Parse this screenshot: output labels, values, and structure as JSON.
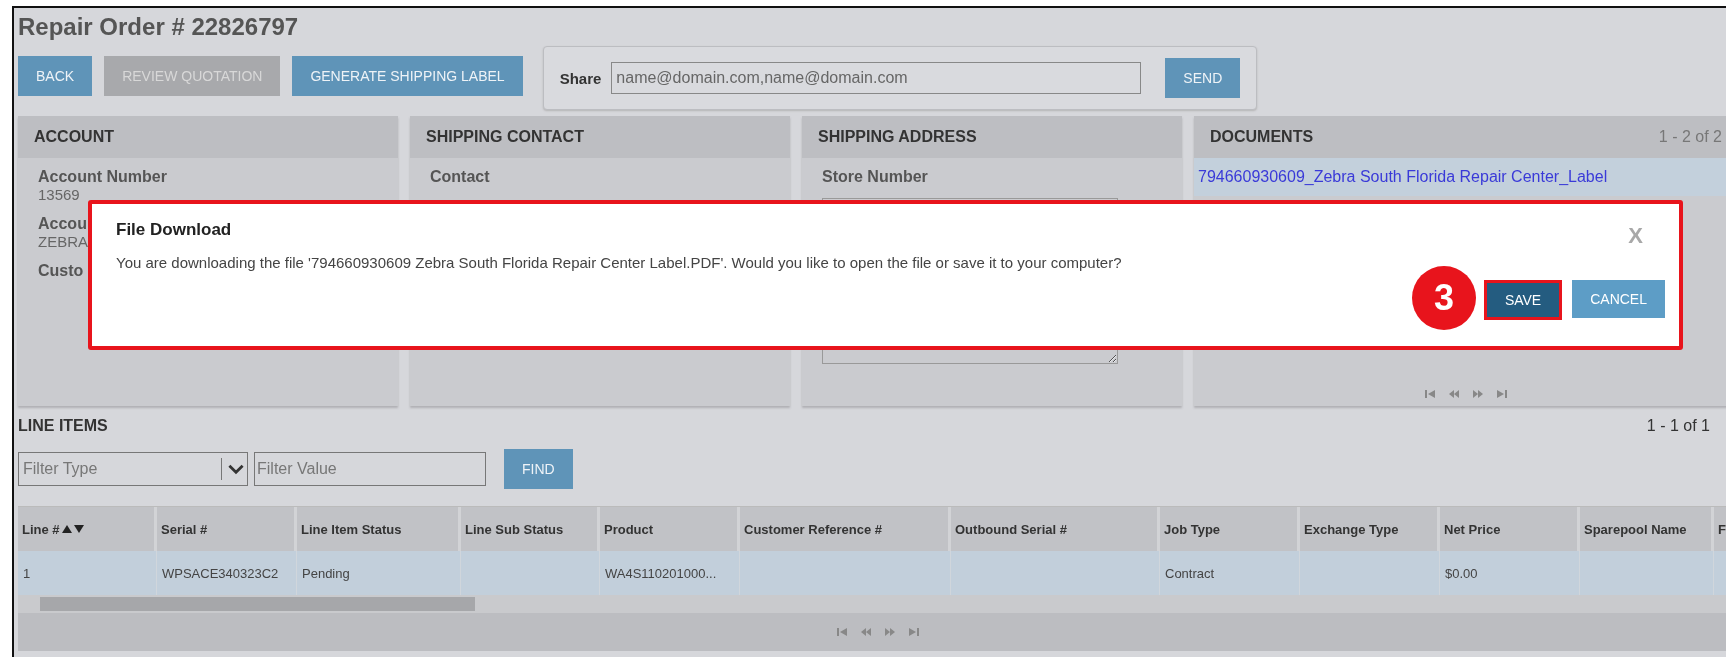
{
  "title": "Repair Order # 22826797",
  "toolbar": [
    {
      "label": "BACK",
      "disabled": false
    },
    {
      "label": "REVIEW QUOTATION",
      "disabled": true
    },
    {
      "label": "GENERATE SHIPPING LABEL",
      "disabled": false
    }
  ],
  "share": {
    "label": "Share",
    "placeholder": "name@domain.com,name@domain.com",
    "button": "SEND"
  },
  "panels": [
    {
      "kind": "fields",
      "title": "ACCOUNT",
      "fields": [
        {
          "kind": "text",
          "label": "Account Number",
          "value": "13569"
        },
        {
          "kind": "text",
          "label": "Accou",
          "value": "ZEBRA"
        },
        {
          "kind": "text",
          "label": "Custo"
        }
      ]
    },
    {
      "kind": "fields",
      "title": "SHIPPING CONTACT",
      "fields": [
        {
          "kind": "text",
          "label": "Contact"
        }
      ]
    },
    {
      "kind": "fields",
      "title": "SHIPPING ADDRESS",
      "fields": [
        {
          "kind": "text",
          "label": "Store Number"
        },
        {
          "kind": "textarea"
        }
      ]
    },
    {
      "kind": "documents",
      "title": "DOCUMENTS",
      "count": "1 - 2 of 2",
      "documents": [
        {
          "name": "794660930609_Zebra South Florida Repair Center_Label",
          "selected": true
        }
      ]
    }
  ],
  "line_items": {
    "title": "LINE ITEMS",
    "count": "1 - 1 of 1",
    "filter_type": {
      "placeholder": "Filter Type"
    },
    "filter_value": {
      "placeholder": "Filter Value"
    },
    "find_button": "FIND",
    "columns": [
      {
        "label": "Line #",
        "sortable": true
      },
      {
        "label": "Serial #",
        "sortable": false
      },
      {
        "label": "Line Item Status",
        "sortable": false
      },
      {
        "label": "Line Sub Status",
        "sortable": false
      },
      {
        "label": "Product",
        "sortable": false
      },
      {
        "label": "Customer Reference #",
        "sortable": false
      },
      {
        "label": "Outbound Serial #",
        "sortable": false
      },
      {
        "label": "Job Type",
        "sortable": false
      },
      {
        "label": "Exchange Type",
        "sortable": false
      },
      {
        "label": "Net Price",
        "sortable": false
      },
      {
        "label": "Sparepool Name",
        "sortable": false
      },
      {
        "label": "F"
      }
    ],
    "rows": [
      {
        "selected": true,
        "cells": [
          "1",
          "WPSACE340323C2",
          "Pending",
          null,
          "WA4S110201000...",
          null,
          null,
          "Contract",
          null,
          "$0.00",
          null,
          null
        ]
      }
    ]
  },
  "dialog": {
    "title": "File Download",
    "message": "You are downloading the file '794660930609  Zebra South Florida Repair Center  Label.PDF'. Would you like to open the file or save it to your computer?",
    "close": "X",
    "buttons": [
      {
        "label": "SAVE",
        "highlighted": true
      },
      {
        "label": "CANCEL",
        "highlighted": false
      }
    ]
  },
  "step_badge": "3"
}
